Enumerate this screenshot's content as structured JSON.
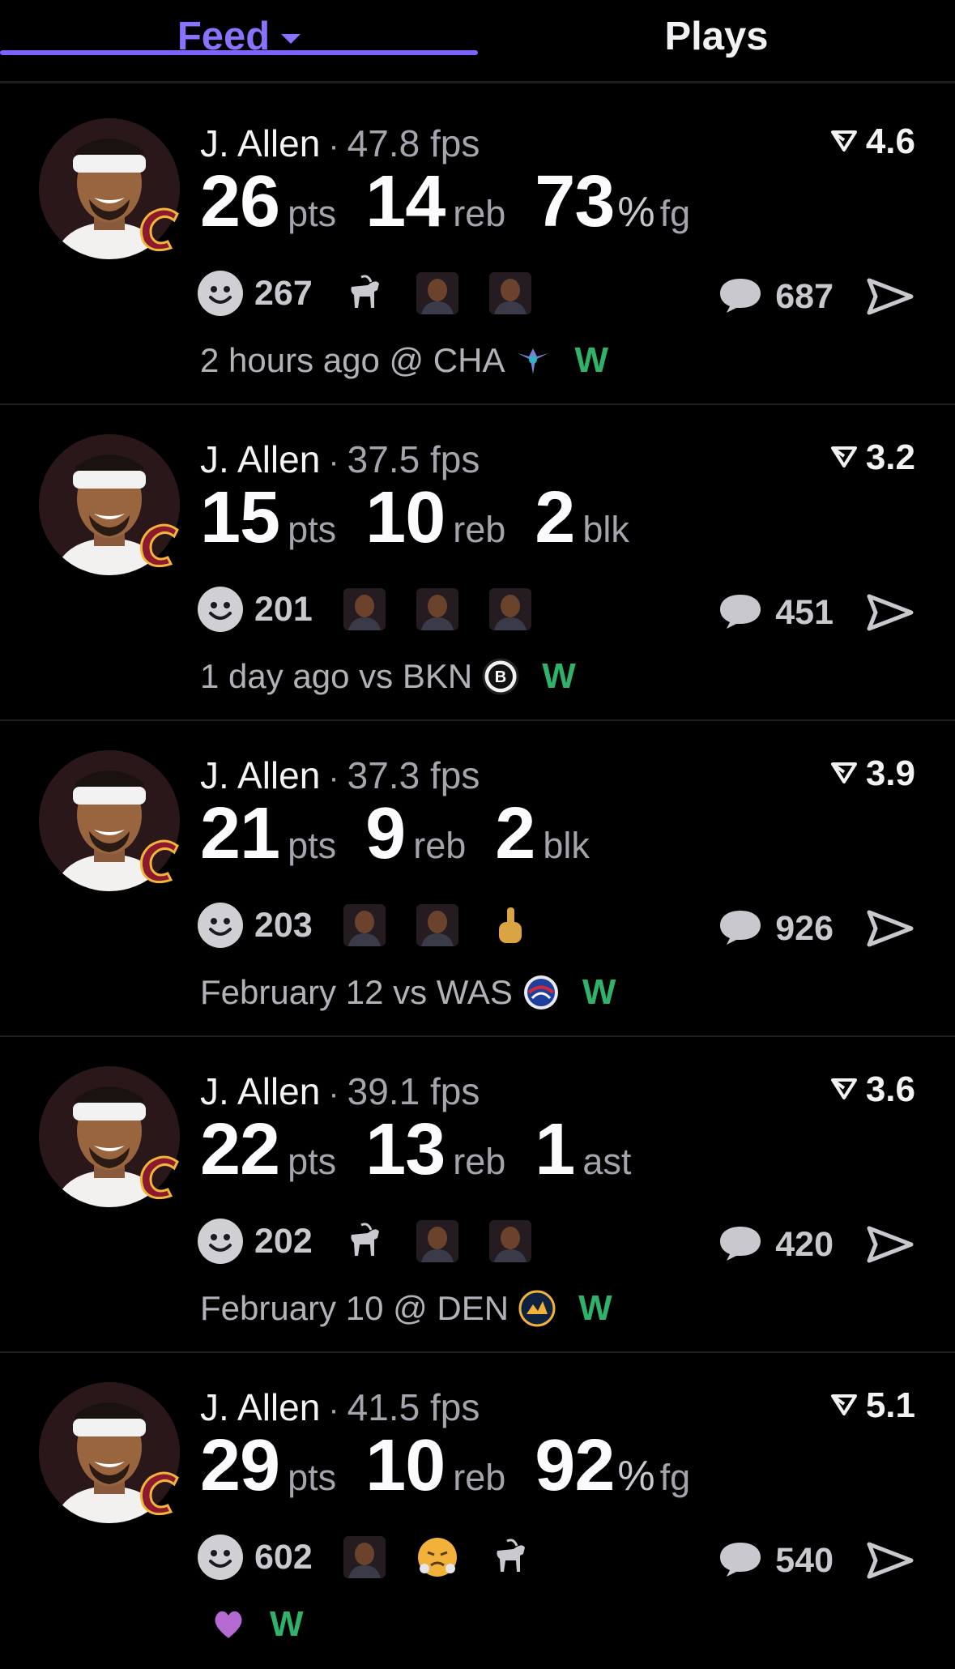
{
  "tabs": {
    "feed": "Feed",
    "plays": "Plays"
  },
  "colors": {
    "accent": "#7a63ff",
    "win": "#2fb36a"
  },
  "feed": [
    {
      "name": "J. Allen",
      "sep": "·",
      "fps": "47.8 fps",
      "rating": "4.6",
      "stats": [
        {
          "value": "26",
          "unit": "pts"
        },
        {
          "value": "14",
          "unit": "reb"
        },
        {
          "value": "73",
          "pct": "%",
          "unit": "fg"
        }
      ],
      "reactions": "267",
      "reaction_icons": [
        "goat-emoji",
        "player-photo-emoji",
        "player-photo-emoji"
      ],
      "comments": "687",
      "meta": "2 hours ago @ CHA",
      "logo": "hornets-logo",
      "result": "W"
    },
    {
      "name": "J. Allen",
      "sep": "·",
      "fps": "37.5 fps",
      "rating": "3.2",
      "stats": [
        {
          "value": "15",
          "unit": "pts"
        },
        {
          "value": "10",
          "unit": "reb"
        },
        {
          "value": "2",
          "unit": "blk"
        }
      ],
      "reactions": "201",
      "reaction_icons": [
        "player-photo-emoji",
        "player-photo-emoji",
        "player-photo-emoji"
      ],
      "comments": "451",
      "meta": "1 day ago vs BKN",
      "logo": "nets-logo",
      "result": "W"
    },
    {
      "name": "J. Allen",
      "sep": "·",
      "fps": "37.3 fps",
      "rating": "3.9",
      "stats": [
        {
          "value": "21",
          "unit": "pts"
        },
        {
          "value": "9",
          "unit": "reb"
        },
        {
          "value": "2",
          "unit": "blk"
        }
      ],
      "reactions": "203",
      "reaction_icons": [
        "player-photo-emoji",
        "player-photo-emoji",
        "middle-finger-emoji"
      ],
      "comments": "926",
      "meta": "February 12 vs WAS",
      "logo": "wizards-logo",
      "result": "W"
    },
    {
      "name": "J. Allen",
      "sep": "·",
      "fps": "39.1 fps",
      "rating": "3.6",
      "stats": [
        {
          "value": "22",
          "unit": "pts"
        },
        {
          "value": "13",
          "unit": "reb"
        },
        {
          "value": "1",
          "unit": "ast"
        }
      ],
      "reactions": "202",
      "reaction_icons": [
        "goat-emoji",
        "player-photo-emoji",
        "player-photo-emoji"
      ],
      "comments": "420",
      "meta": "February 10 @ DEN",
      "logo": "nuggets-logo",
      "result": "W"
    },
    {
      "name": "J. Allen",
      "sep": "·",
      "fps": "41.5 fps",
      "rating": "5.1",
      "stats": [
        {
          "value": "29",
          "unit": "pts"
        },
        {
          "value": "10",
          "unit": "reb"
        },
        {
          "value": "92",
          "pct": "%",
          "unit": "fg"
        }
      ],
      "reactions": "602",
      "reaction_icons": [
        "player-photo-emoji",
        "steam-face-emoji",
        "goat-emoji"
      ],
      "comments": "540",
      "meta": "",
      "logo": "purple-heart-logo",
      "result": "W"
    }
  ]
}
